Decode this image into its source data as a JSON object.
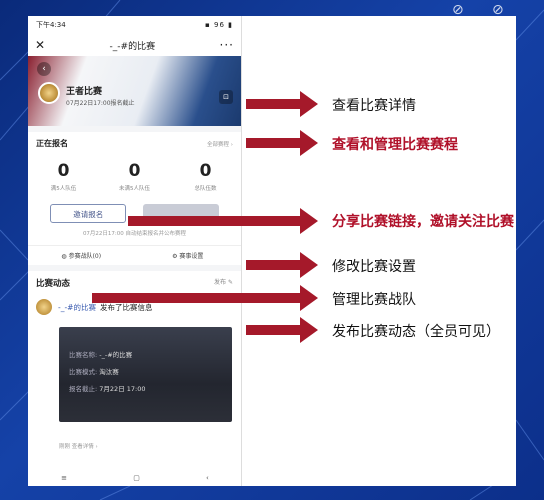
{
  "status_bar": {
    "time": "下午4:34",
    "right": "▪ 96 ▮"
  },
  "nav": {
    "close": "✕",
    "title": "-_-#的比赛",
    "more": "···"
  },
  "banner": {
    "game_name": "王者比赛",
    "date_text": "07月22日17:00报名截止",
    "back": "‹",
    "share": "⊡"
  },
  "registration": {
    "title": "正在报名",
    "all_link": "全部赛程 ›",
    "stats": [
      {
        "value": "0",
        "label": "满5人队伍"
      },
      {
        "value": "0",
        "label": "未满5人队伍"
      },
      {
        "value": "0",
        "label": "总队伍数"
      }
    ],
    "invite_label": "邀请报名",
    "notice": "07月22日17:00 自动结束报名并公布赛程",
    "tab_teams": "参赛战队(0)",
    "tab_settings": "赛事设置"
  },
  "dynamics": {
    "title": "比赛动态",
    "publish": "发布",
    "post_user": "-_-#的比赛",
    "post_action": "发布了比赛信息",
    "info_rows": [
      {
        "key": "比赛名称:",
        "value": "-_-#的比赛"
      },
      {
        "key": "比赛模式:",
        "value": "淘汰赛"
      },
      {
        "key": "报名截止:",
        "value": "7月22日 17:00"
      }
    ],
    "footer": "刚刚  查看详情 ›"
  },
  "annotations": [
    {
      "text": "查看比赛详情",
      "highlight": false
    },
    {
      "text": "查看和管理比赛赛程",
      "highlight": true
    },
    {
      "text": "分享比赛链接，邀请关注比赛",
      "highlight": true
    },
    {
      "text": "修改比赛设置",
      "highlight": false
    },
    {
      "text": "管理比赛战队",
      "highlight": false
    },
    {
      "text": "发布比赛动态（全员可见）",
      "highlight": false
    }
  ],
  "colors": {
    "arrow": "#a5192a",
    "highlight": "#b0112a",
    "background": "#0d2f86"
  }
}
